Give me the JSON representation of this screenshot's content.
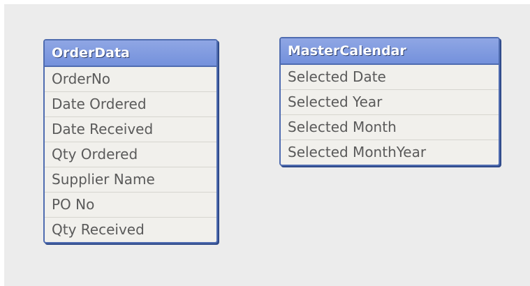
{
  "tables": {
    "orderdata": {
      "title": "OrderData",
      "fields": [
        "OrderNo",
        "Date Ordered",
        "Date Received",
        "Qty Ordered",
        "Supplier Name",
        "PO No",
        "Qty Received"
      ]
    },
    "mastercalendar": {
      "title": "MasterCalendar",
      "fields": [
        "Selected Date",
        "Selected Year",
        "Selected Month",
        "Selected MonthYear"
      ]
    }
  },
  "colors": {
    "header": "#7f9ae0",
    "border": "#4f6cb0",
    "background": "#ececec",
    "row": "#f1f0ec"
  }
}
